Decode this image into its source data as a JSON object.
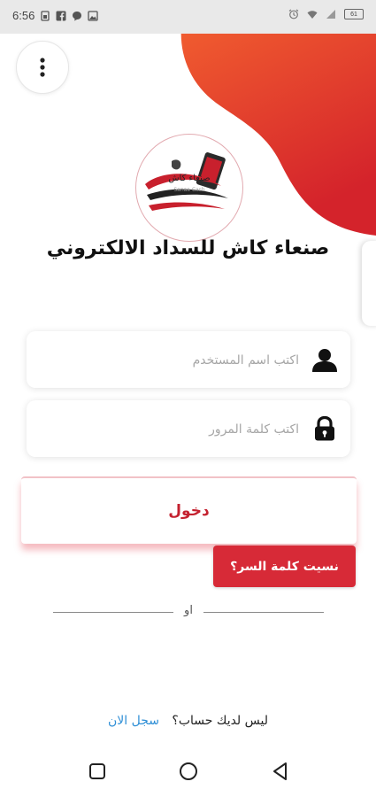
{
  "status_bar": {
    "time": "6:56",
    "left_icons": [
      "sim-card-icon",
      "facebook-icon",
      "message-icon",
      "image-icon"
    ],
    "right_icons": [
      "alarm-icon",
      "wifi-icon",
      "signal-icon",
      "battery-icon"
    ],
    "battery_level": "61"
  },
  "colors": {
    "accent": "#d72a37",
    "blob_top": "#f25a25",
    "blob_bottom": "#d4232b",
    "link": "#2f8fd6"
  },
  "header": {
    "menu_icon": "more-vertical-icon",
    "app_title": "صنعاء كاش للسداد الالكتروني"
  },
  "logo": {
    "text": "صنعاء كاش",
    "subtext": "Sanaa Cash"
  },
  "form": {
    "username_placeholder": "اكتب اسم المستخدم",
    "username_icon": "user-icon",
    "password_placeholder": "اكتب كلمة المرور",
    "password_icon": "lock-icon",
    "login_label": "دخول",
    "forgot_label": "نسيت كلمة السر؟",
    "or_label": "او"
  },
  "signup": {
    "prompt": "ليس لديك حساب؟",
    "link": "سجل الان"
  },
  "nav_bar": {
    "icons": [
      "recent-apps-icon",
      "home-icon",
      "back-icon"
    ]
  }
}
